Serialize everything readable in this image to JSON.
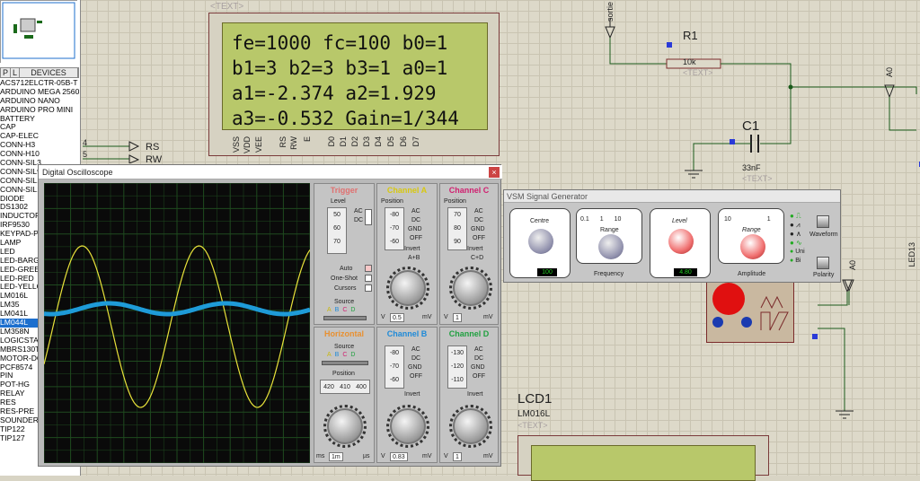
{
  "sidebar": {
    "tabs": [
      "P",
      "L",
      "DEVICES"
    ],
    "devices": [
      "ACS712ELCTR-05B-T",
      "ARDUINO MEGA 2560",
      "ARDUINO NANO",
      "ARDUINO PRO MINI",
      "BATTERY",
      "CAP",
      "CAP-ELEC",
      "CONN-H3",
      "CONN-H10",
      "CONN-SIL3",
      "CONN-SIL9",
      "CONN-SIL12",
      "CONN-SIL18",
      "DIODE",
      "DS1302",
      "INDUCTOR",
      "IRF9530",
      "KEYPAD-PH",
      "LAMP",
      "LED",
      "LED-BARGR",
      "LED-GREEN",
      "LED-RED",
      "LED-YELLOW",
      "LM016L",
      "LM35",
      "LM041L",
      "LM044L",
      "LM358N",
      "LOGICSTATE",
      "MBRS130T3",
      "MOTOR-DC",
      "PCF8574",
      "PIN",
      "POT-HG",
      "RELAY",
      "RES",
      "RES-PRE",
      "SOUNDER",
      "TIP122",
      "TIP127"
    ],
    "selected_index": 27
  },
  "schematic": {
    "text_placeholder": "<TEXT>",
    "lcd_lines": [
      "fe=1000 fc=100 b0=1",
      "b1=3 b2=3 b3=1 a0=1",
      "a1=-2.374 a2=1.929",
      "a3=-0.532 Gain=1/344"
    ],
    "lcd_pins": [
      "VSS",
      "VDD",
      "VEE",
      "RS",
      "RW",
      "E",
      "D0",
      "D1",
      "D2",
      "D3",
      "D4",
      "D5",
      "D6",
      "D7"
    ],
    "pin4": "4",
    "pin5": "5",
    "rs": "RS",
    "rw": "RW",
    "sortie": "sortie",
    "r1_name": "R1",
    "r1_value": "10k",
    "c1_name": "C1",
    "c1_value": "33nF",
    "a0_top": "A0",
    "a0_right": "A0",
    "led13": "LED13",
    "lcd1_name": "LCD1",
    "lcd1_model": "LM016L"
  },
  "oscilloscope": {
    "title": "Digital Oscilloscope",
    "close": "×",
    "trigger": {
      "header": "Trigger",
      "level": "Level",
      "ticks": [
        "50",
        "60",
        "70"
      ],
      "ac": "AC",
      "dc": "DC",
      "auto": "Auto",
      "oneshot": "One-Shot",
      "cursors": "Cursors",
      "source": "Source",
      "src_opts": [
        "A",
        "B",
        "C",
        "D"
      ]
    },
    "channelA": {
      "header": "Channel A",
      "position": "Position",
      "ticks": [
        "-80",
        "-70",
        "-60"
      ],
      "ac": "AC",
      "dc": "DC",
      "gnd": "GND",
      "off": "OFF",
      "invert": "Invert",
      "aplusb": "A+B",
      "val": "0.5",
      "unit_v": "V",
      "unit_mv": "mV"
    },
    "channelC": {
      "header": "Channel C",
      "position": "Position",
      "ticks": [
        "70",
        "80",
        "90"
      ],
      "ac": "AC",
      "dc": "DC",
      "gnd": "GND",
      "off": "OFF",
      "invert": "Invert",
      "cplusd": "C+D",
      "val": "1",
      "unit_v": "V",
      "unit_mv": "mV"
    },
    "horizontal": {
      "header": "Horizontal",
      "source": "Source",
      "src_opts": [
        "A",
        "B",
        "C",
        "D"
      ],
      "position": "Position",
      "pos_vals": [
        "420",
        "410",
        "400"
      ],
      "unit_ms": "ms",
      "val": "1m",
      "unit_us": "µs"
    },
    "channelB": {
      "header": "Channel B",
      "ticks": [
        "-80",
        "-70",
        "-60"
      ],
      "ac": "AC",
      "dc": "DC",
      "gnd": "GND",
      "off": "OFF",
      "invert": "Invert",
      "val": "0.83",
      "unit_v": "V",
      "unit_mv": "mV"
    },
    "channelD": {
      "header": "Channel D",
      "ticks": [
        "-130",
        "-120",
        "-110"
      ],
      "ac": "AC",
      "dc": "DC",
      "gnd": "GND",
      "off": "OFF",
      "invert": "Invert",
      "val": "1",
      "unit_v": "V",
      "unit_mv": "mV"
    },
    "colors": {
      "trace_a": "#e8e23a",
      "trace_b": "#1e9bd8",
      "trigger": "#e07070",
      "chA": "#e8d820",
      "chB": "#1e8ad8",
      "chC": "#d02070",
      "chD": "#20a040",
      "horiz": "#e89030"
    }
  },
  "signal_generator": {
    "title": "VSM Signal Generator",
    "centre": "Centre",
    "centre_ticks": [
      "3",
      "4",
      "5",
      "6",
      "7",
      "8",
      "9",
      "10",
      "11",
      "12",
      "2",
      "1",
      "0"
    ],
    "centre_val": "100",
    "range": "Range",
    "range_ticks": [
      "0.1",
      "1",
      "10"
    ],
    "frequency": "Frequency",
    "level": "Level",
    "level_ticks": [
      "3",
      "4",
      "5",
      "6",
      "7",
      "8",
      "9",
      "10",
      "11",
      "12",
      "2",
      "1",
      "0"
    ],
    "level_val": "4.80",
    "amp_range": "Range",
    "amp_ticks": [
      "10",
      "1"
    ],
    "amplitude": "Amplitude",
    "hz": "Hz",
    "khz": "kHz",
    "mv": "mV",
    "v": "V",
    "mhz": "MHz",
    "waveform": "Waveform",
    "polarity": "Polarity",
    "uni": "Uni",
    "bi": "Bi"
  }
}
